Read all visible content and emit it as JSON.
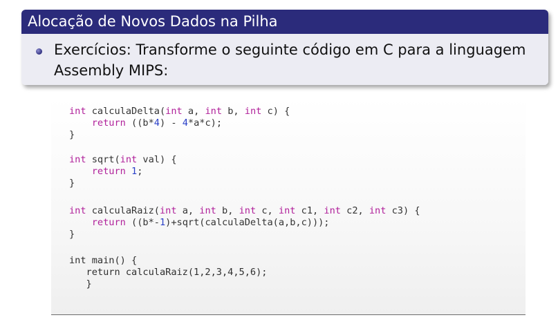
{
  "slide": {
    "title": "Alocação de Novos Dados na Pilha",
    "bullet_text": "Exercícios: Transforme o seguinte código em C para a linguagem Assembly MIPS:"
  },
  "colors": {
    "title_bar": "#2b2b7b",
    "block_body": "#ececf3",
    "keyword": "#b0209a",
    "number": "#2a40c8",
    "code_text": "#333333"
  },
  "code": {
    "l1": {
      "kw1": "int",
      "t1": " calculaDelta(",
      "kw2": "int",
      "t2": " a, ",
      "kw3": "int",
      "t3": " b, ",
      "kw4": "int",
      "t4": " c) {"
    },
    "l2": {
      "t0": "    ",
      "kw1": "return",
      "t1": " ((b*",
      "n1": "4",
      "t2": ") - ",
      "n2": "4",
      "t3": "*a*c);"
    },
    "l3": {
      "t1": "}"
    },
    "l4": {
      "kw1": "int",
      "t1": " sqrt(",
      "kw2": "int",
      "t2": " val) {"
    },
    "l5": {
      "t0": "    ",
      "kw1": "return",
      "t1": " ",
      "n1": "1",
      "t2": ";"
    },
    "l6": {
      "t1": "}"
    },
    "l7": {
      "kw1": "int",
      "t1": " calculaRaiz(",
      "kw2": "int",
      "t2": " a, ",
      "kw3": "int",
      "t3": " b, ",
      "kw4": "int",
      "t4": " c, ",
      "kw5": "int",
      "t5": " c1, ",
      "kw6": "int",
      "t6": " c2, ",
      "kw7": "int",
      "t7": " c3) {"
    },
    "l8": {
      "t0": "    ",
      "kw1": "return",
      "t1": " ((b*-",
      "n1": "1",
      "t2": ")+sqrt(calculaDelta(a,b,c)));"
    },
    "l9": {
      "t1": "}"
    },
    "l10": {
      "t1": "int main() {"
    },
    "l11": {
      "t1": "   return calculaRaiz(1,2,3,4,5,6);"
    },
    "l12": {
      "t1": "   }"
    }
  }
}
